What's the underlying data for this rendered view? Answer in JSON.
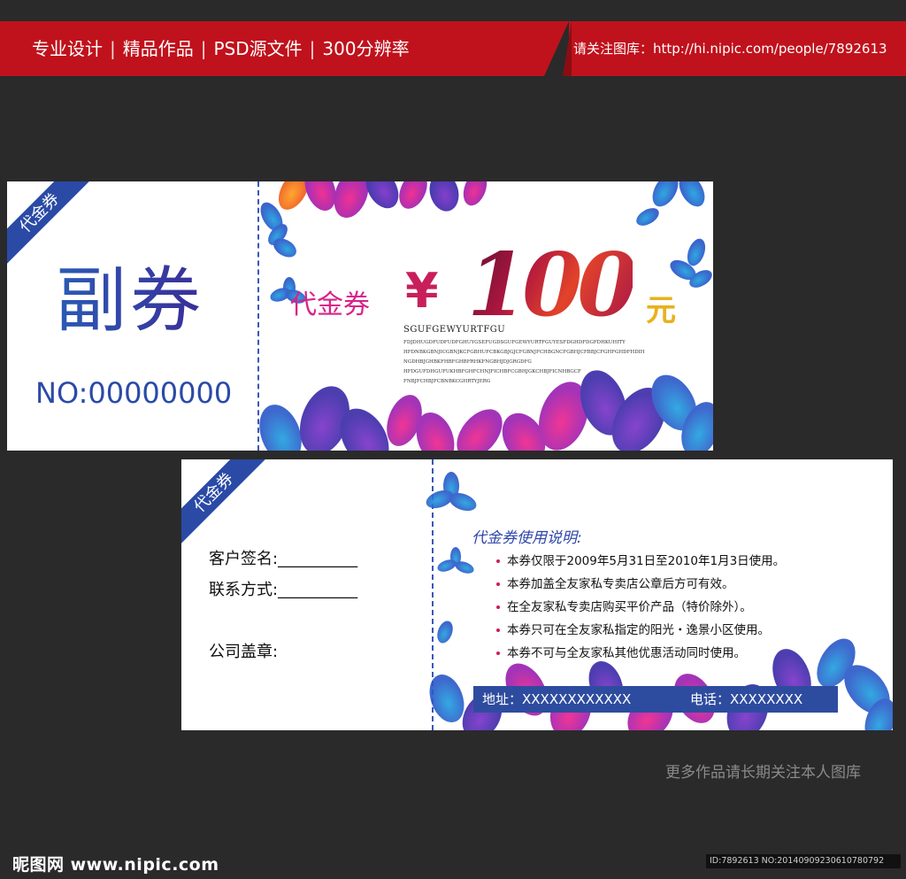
{
  "banner": {
    "items": [
      "专业设计",
      "精品作品",
      "PSD源文件",
      "300分辨率"
    ],
    "separator": "|",
    "right_text": "请关注图库：http://hi.nipic.com/people/7892613"
  },
  "ticket_front": {
    "ribbon": "代金券",
    "stub_title": "副券",
    "serial": "NO:00000000",
    "label": "代金券",
    "currency": "¥",
    "amount": "100",
    "unit": "元",
    "small_heading": "SGUFGEWYURTFGU",
    "small_lines": [
      "FDJDHUGDFUDFUDFGHUYGSEFUGDSGUFGEWYURTFGUYESFDGHDFDGFDHKUHITY",
      "HFDNBKGBNJICGBNJKCFGBHUFCBKGBJGJCFGBNJFCHBGNCFGBHJCFBBJCFGHFGHDFHDIH",
      "NGDHBJGHBKFHBFGHBFRHKFNGBHJDJGRGDFG",
      "HFDGUFDHGUFUKHBFGHFCHNJFICHBFCGBHJGKCHBJFICNHBGCF",
      "FNBJFCHBJFCBNBKCGHRTYJERG"
    ]
  },
  "ticket_back": {
    "ribbon": "代金券",
    "field_signature": "客户签名:__________",
    "field_contact": "联系方式:__________",
    "field_stamp": "公司盖章:",
    "instructions_title": "代金券使用说明:",
    "rules": [
      "本券仅限于2009年5月31日至2010年1月3日使用。",
      "本券加盖全友家私专卖店公章后方可有效。",
      "在全友家私专卖店购买平价产品（特价除外）。",
      "本券只可在全友家私指定的阳光・逸景小区使用。",
      "本券不可与全友家私其他优惠活动同时使用。"
    ],
    "address": "地址：XXXXXXXXXXXX",
    "phone": "电话：XXXXXXXX"
  },
  "footer": {
    "more_text": "更多作品请长期关注本人图库",
    "logo": "昵图网 www.nipic.com",
    "id_text": "ID:7892613 NO:20140909230610780792"
  },
  "colors": {
    "banner_red": "#c0121c",
    "ribbon_blue": "#2a4aa6",
    "magenta": "#d8238a",
    "gold": "#e7b21c",
    "background": "#2a2a2a"
  }
}
